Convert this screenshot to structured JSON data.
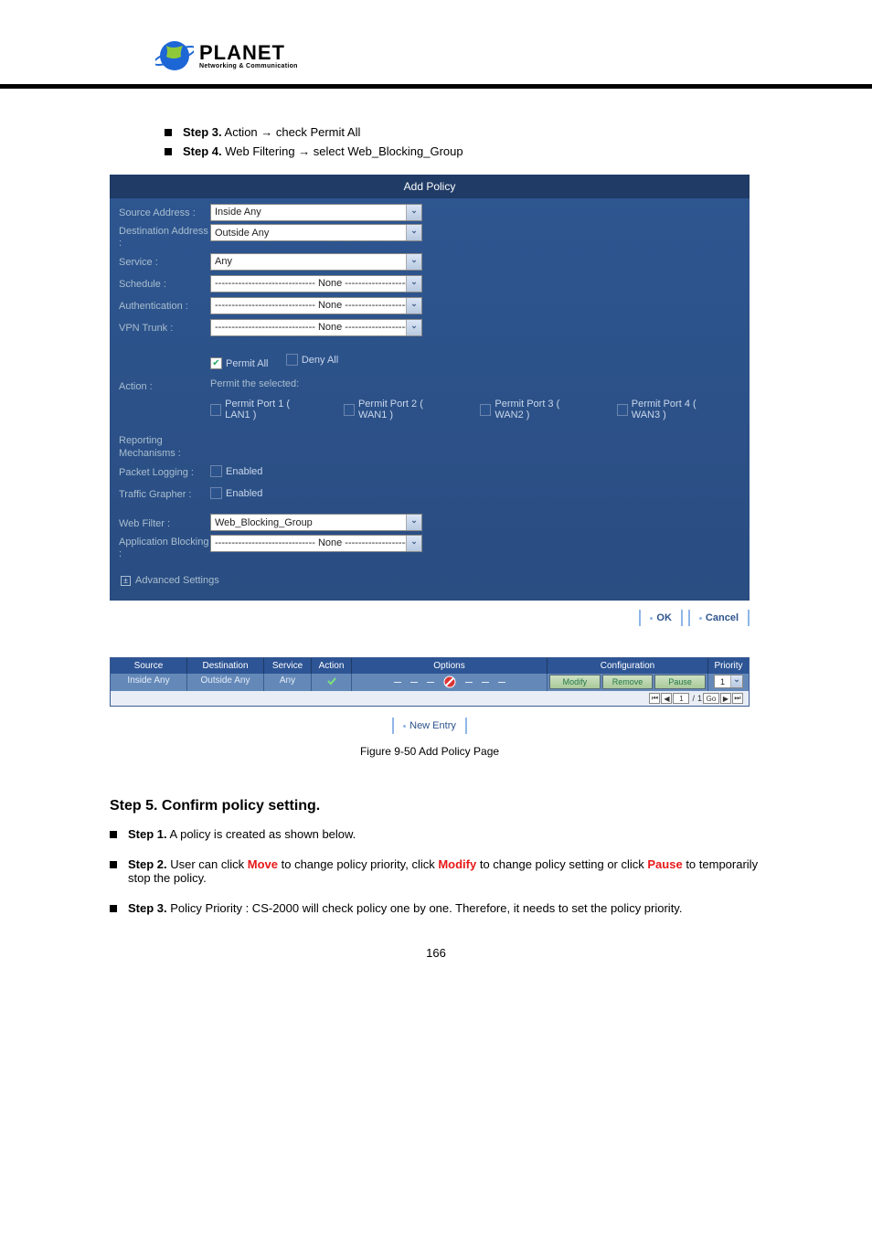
{
  "logo": {
    "name": "PLANET",
    "tagline": "Networking & Communication"
  },
  "top_steps": [
    {
      "label": "Step 3.",
      "text": " Action → check Permit All"
    },
    {
      "label": "Step 4.",
      "text": " Web Filtering → select Web_Blocking_Group"
    }
  ],
  "panel": {
    "title": "Add Policy",
    "rows": {
      "source_address": {
        "label": "Source Address :",
        "value": "Inside Any"
      },
      "destination_address": {
        "label": "Destination Address :",
        "value": "Outside Any"
      },
      "service": {
        "label": "Service :",
        "value": "Any"
      },
      "schedule": {
        "label": "Schedule :",
        "value": "------------------------------ None ------------------------------"
      },
      "authentication": {
        "label": "Authentication :",
        "value": "------------------------------ None ------------------------------"
      },
      "vpn_trunk": {
        "label": "VPN Trunk :",
        "value": "------------------------------ None ------------------------------"
      },
      "action": {
        "label": "Action :",
        "permit_all": {
          "label": "Permit All",
          "checked": true
        },
        "deny_all": {
          "label": "Deny All",
          "checked": false
        },
        "permit_selected_label": "Permit the selected:",
        "ports": [
          "Permit Port  1  ( LAN1 )",
          "Permit Port  2  ( WAN1 )",
          "Permit Port  3  ( WAN2 )",
          "Permit Port  4  ( WAN3 )"
        ]
      },
      "reporting_label": "Reporting Mechanisms :",
      "packet_logging": {
        "label": "Packet Logging :",
        "cb_label": "Enabled"
      },
      "traffic_grapher": {
        "label": "Traffic Grapher :",
        "cb_label": "Enabled"
      },
      "web_filter": {
        "label": "Web Filter :",
        "value": "Web_Blocking_Group"
      },
      "application_blocking": {
        "label": "Application Blocking :",
        "value": "------------------------------ None ------------------------------"
      }
    },
    "advanced": "Advanced Settings",
    "ok": "OK",
    "cancel": "Cancel"
  },
  "table": {
    "headers": {
      "source": "Source",
      "destination": "Destination",
      "service": "Service",
      "action": "Action",
      "options": "Options",
      "configuration": "Configuration",
      "priority": "Priority"
    },
    "row": {
      "source": "Inside Any",
      "destination": "Outside Any",
      "service": "Any",
      "modify": "Modify",
      "remove": "Remove",
      "pause": "Pause",
      "priority": "1"
    },
    "pager": {
      "total": "1",
      "current": "1"
    },
    "new_entry": "New Entry"
  },
  "figure_label": "Figure 9-50 Add Policy Page",
  "step5": {
    "heading": "Step 5. Confirm policy setting.",
    "items": [
      {
        "label": "Step 1.",
        "text": " A policy is created as shown below."
      },
      {
        "label": "Step 2.",
        "html": " User can click <span class='red'>Move</span> to change policy priority, click <span class='red'>Modify</span> to change policy setting or click <span class='red'>Pause</span> to temporarily stop the policy."
      },
      {
        "label": "Step 3.",
        "text": " Policy Priority : CS-2000 will check policy one by one. Therefore, it needs to set the policy priority."
      }
    ]
  },
  "page_number": "166"
}
